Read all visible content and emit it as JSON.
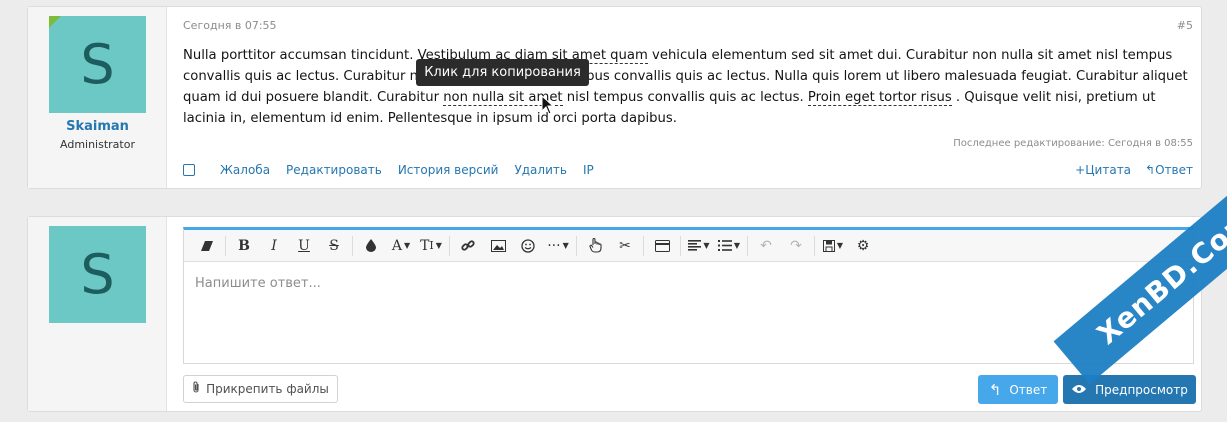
{
  "post": {
    "avatar_letter": "S",
    "username": "Skaiman",
    "user_title": "Administrator",
    "date": "Сегодня в 07:55",
    "number": "#5",
    "body": {
      "p1": "Nulla porttitor accumsan tincidunt. ",
      "link1": "Vestibulum ac diam sit amet quam",
      "p2": " vehicula elementum sed sit amet dui. Curabitur non nulla sit amet nisl tempus convallis quis ac lectus. Curabitur non nulla sit amet nisl tempus convallis quis ac lectus. Nulla quis lorem ut libero malesuada feugiat. Curabitur aliquet quam id dui posuere blandit. Curabitur ",
      "link2": "non nulla sit amet",
      "p3": " nisl tempus convallis quis ac lectus. ",
      "link3": "Proin eget tortor risus",
      "p4": " . Quisque velit nisi, pretium ut lacinia in, elementum id enim. Pellentesque in ipsum id orci porta dapibus."
    },
    "edited": "Последнее редактирование: Сегодня в 08:55",
    "actions": [
      "Жалоба",
      "Редактировать",
      "История версий",
      "Удалить",
      "IP"
    ],
    "quote_label": "Цитата",
    "reply_label": "Ответ",
    "tooltip": "Клик для копирования"
  },
  "reply_form": {
    "avatar_letter": "S",
    "placeholder": "Напишите ответ...",
    "attach_label": "Прикрепить файлы",
    "reply_label": "Ответ",
    "preview_label": "Предпросмотр"
  },
  "toolbar_icons": [
    "eraser-icon",
    "bold-icon",
    "italic-icon",
    "underline-icon",
    "strikethrough-icon",
    "color-icon",
    "font-size-icon",
    "font-family-icon",
    "link-icon",
    "image-icon",
    "smilie-icon",
    "more-icon",
    "hand-icon",
    "scissors-icon",
    "card-icon",
    "align-icon",
    "list-icon",
    "undo-icon",
    "redo-icon",
    "drafts-icon",
    "settings-icon"
  ],
  "watermark": "XenBD.Com",
  "colors": {
    "accent": "#47a7eb",
    "link": "#2577b1",
    "avatar_bg": "#6cc8c4"
  }
}
